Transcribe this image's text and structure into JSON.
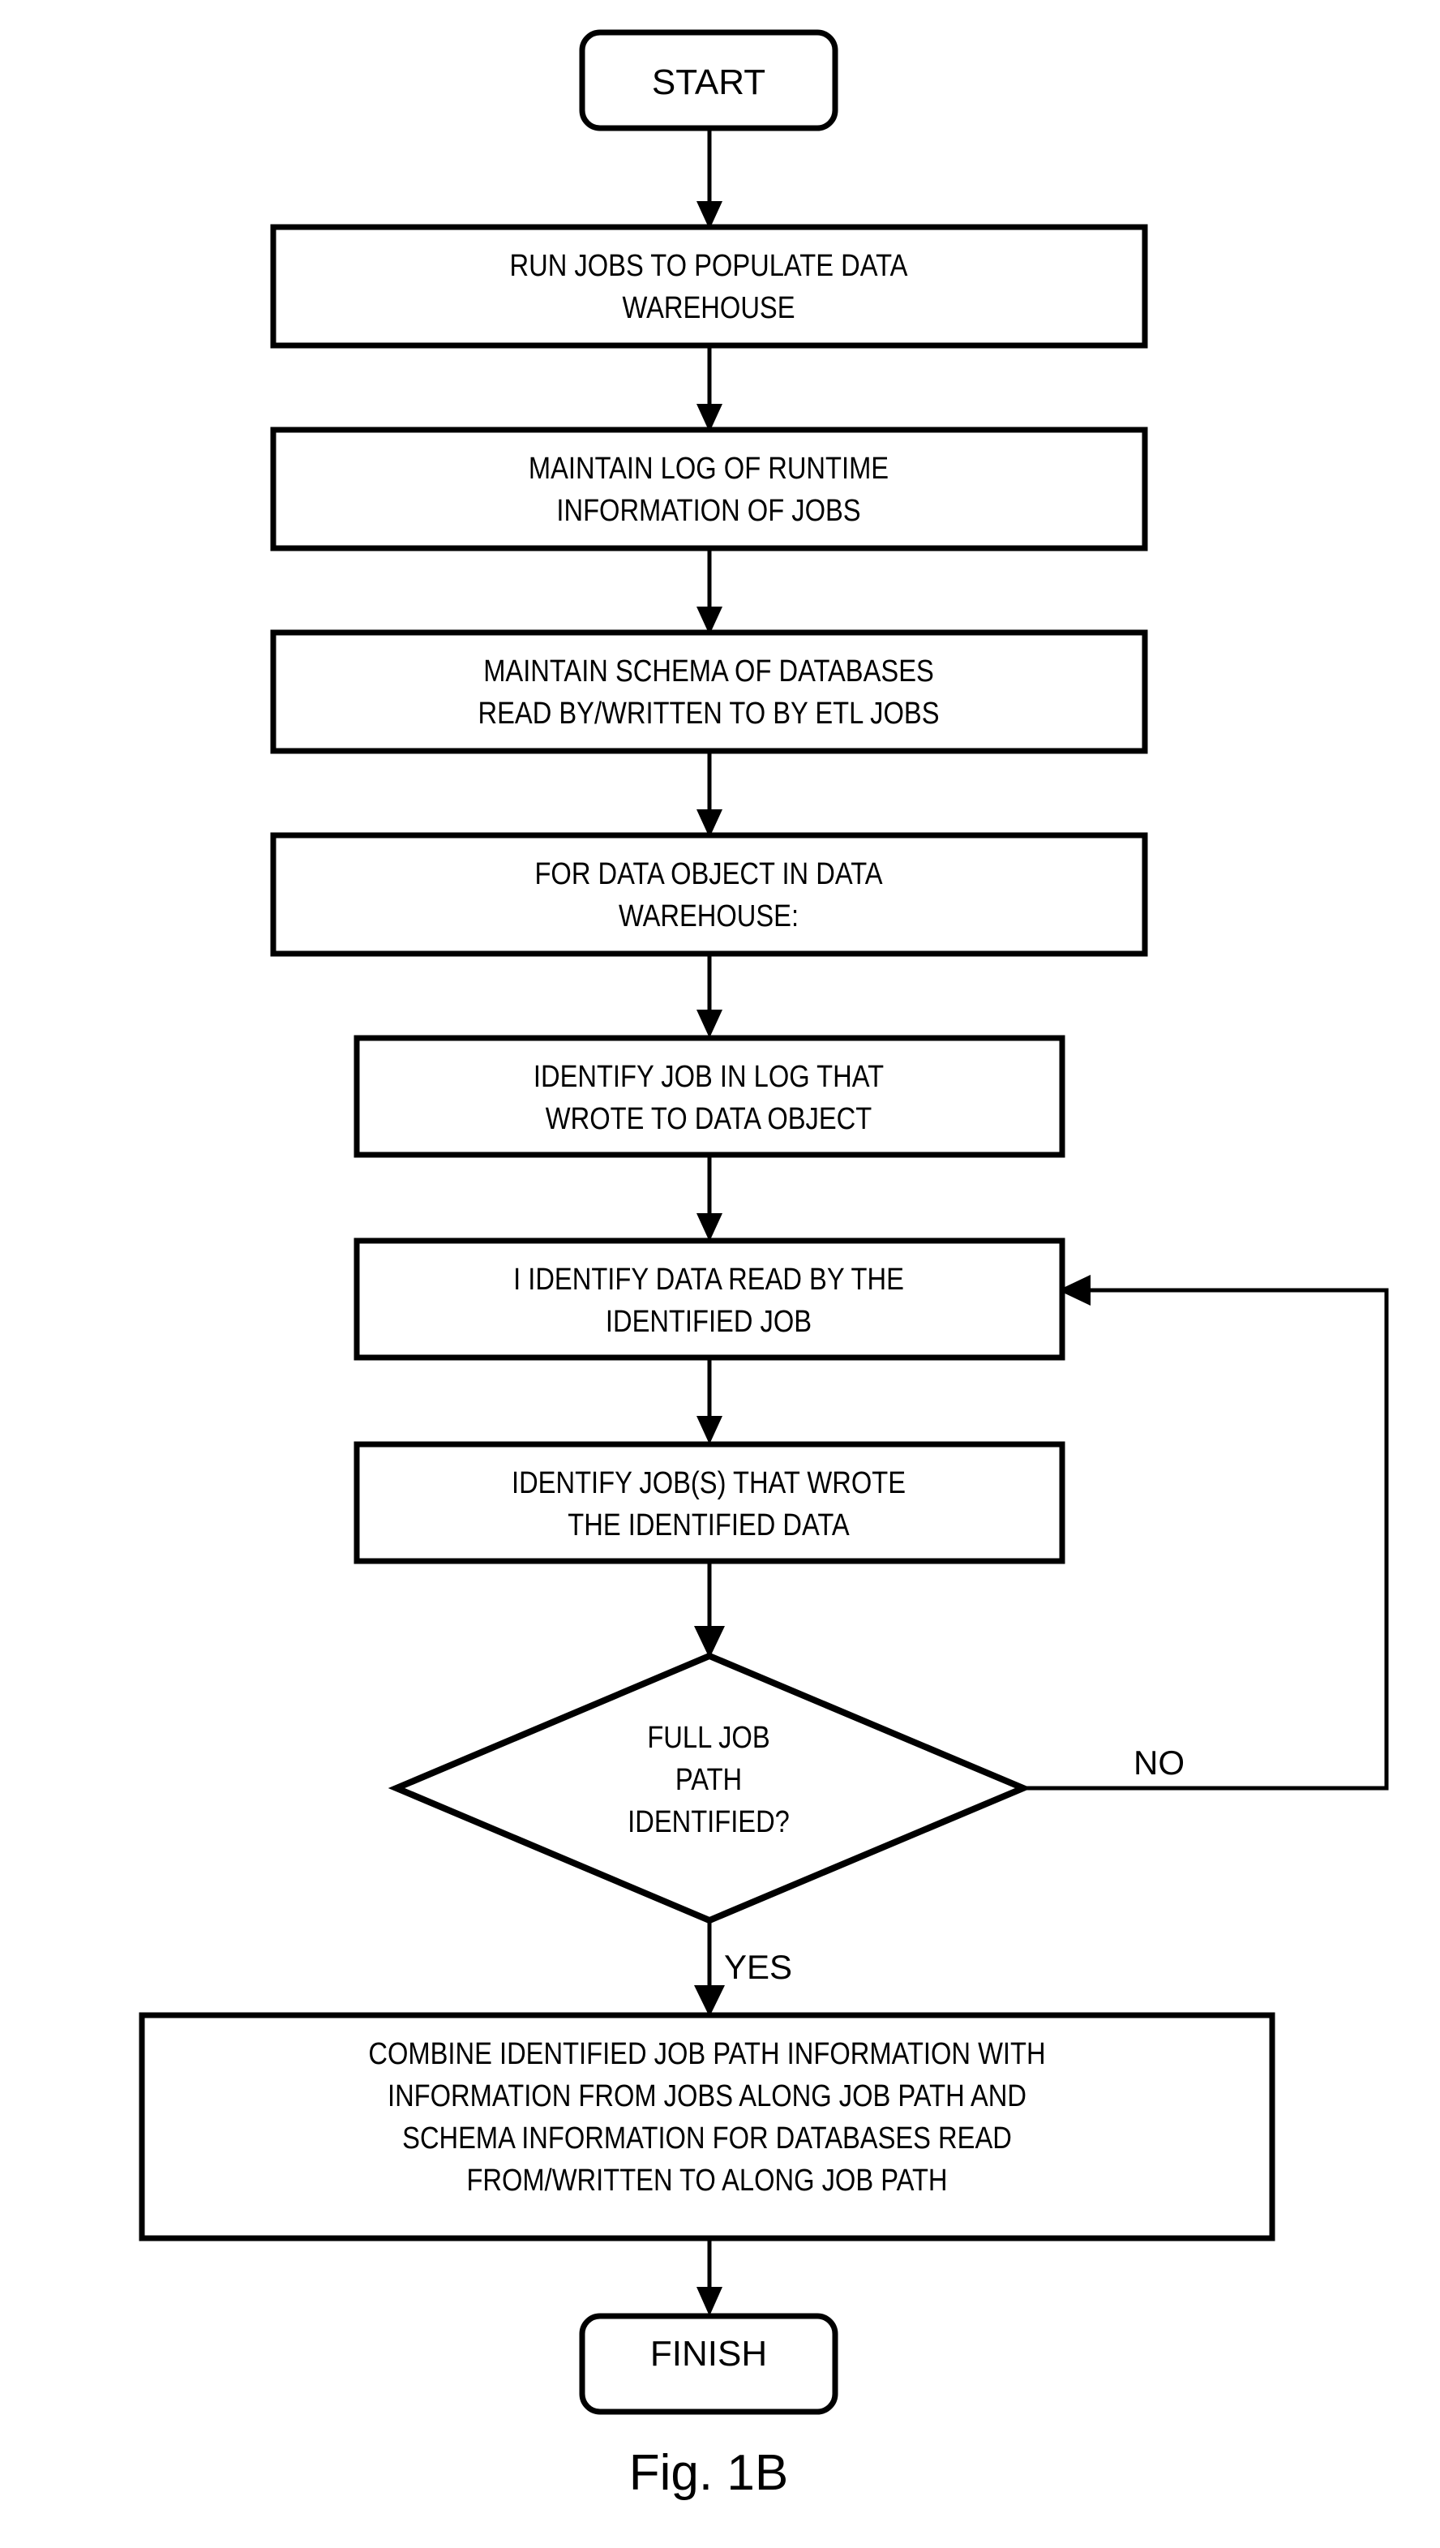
{
  "figure": {
    "caption": "Fig. 1B",
    "title": "ETL job path lineage flowchart"
  },
  "colors": {
    "stroke": "#000000",
    "fill": "#ffffff",
    "text": "#000000",
    "background": "#ffffff"
  },
  "nodes": {
    "start": {
      "id": "start",
      "type": "terminator",
      "label": "START"
    },
    "run_jobs": {
      "id": "run_jobs",
      "type": "process",
      "lines": [
        "RUN JOBS TO POPULATE DATA",
        "WAREHOUSE"
      ]
    },
    "maintain_log": {
      "id": "maintain_log",
      "type": "process",
      "lines": [
        "MAINTAIN LOG OF RUNTIME",
        "INFORMATION OF JOBS"
      ]
    },
    "maintain_schema": {
      "id": "maintain_schema",
      "type": "process",
      "lines": [
        "MAINTAIN SCHEMA OF DATABASES",
        "READ BY/WRITTEN TO BY ETL JOBS"
      ]
    },
    "for_data_object": {
      "id": "for_data_object",
      "type": "process",
      "lines": [
        "FOR DATA OBJECT IN DATA",
        "WAREHOUSE:"
      ]
    },
    "identify_job_in_log": {
      "id": "identify_job_in_log",
      "type": "process",
      "lines": [
        "IDENTIFY JOB IN LOG THAT",
        "WROTE TO DATA OBJECT"
      ]
    },
    "identify_data_read": {
      "id": "identify_data_read",
      "type": "process",
      "lines": [
        "I IDENTIFY DATA READ BY THE",
        "IDENTIFIED JOB"
      ]
    },
    "identify_jobs_wrote": {
      "id": "identify_jobs_wrote",
      "type": "process",
      "lines": [
        "IDENTIFY JOB(S) THAT WROTE",
        "THE IDENTIFIED DATA"
      ]
    },
    "full_job_path": {
      "id": "full_job_path",
      "type": "decision",
      "lines": [
        "FULL JOB",
        "PATH",
        "IDENTIFIED?"
      ]
    },
    "combine": {
      "id": "combine",
      "type": "process",
      "lines": [
        "COMBINE IDENTIFIED JOB PATH INFORMATION WITH",
        "INFORMATION FROM JOBS ALONG JOB PATH AND",
        "SCHEMA INFORMATION FOR DATABASES READ",
        "FROM/WRITTEN TO ALONG JOB PATH"
      ]
    },
    "finish": {
      "id": "finish",
      "type": "terminator",
      "label": "FINISH"
    }
  },
  "edges": [
    {
      "id": "e1",
      "from": "start",
      "to": "run_jobs",
      "label": ""
    },
    {
      "id": "e2",
      "from": "run_jobs",
      "to": "maintain_log",
      "label": ""
    },
    {
      "id": "e3",
      "from": "maintain_log",
      "to": "maintain_schema",
      "label": ""
    },
    {
      "id": "e4",
      "from": "maintain_schema",
      "to": "for_data_object",
      "label": ""
    },
    {
      "id": "e5",
      "from": "for_data_object",
      "to": "identify_job_in_log",
      "label": ""
    },
    {
      "id": "e6",
      "from": "identify_job_in_log",
      "to": "identify_data_read",
      "label": ""
    },
    {
      "id": "e7",
      "from": "identify_data_read",
      "to": "identify_jobs_wrote",
      "label": ""
    },
    {
      "id": "e8",
      "from": "identify_jobs_wrote",
      "to": "full_job_path",
      "label": ""
    },
    {
      "id": "e9",
      "from": "full_job_path",
      "to": "combine",
      "label": "YES"
    },
    {
      "id": "e10",
      "from": "full_job_path",
      "to": "identify_data_read",
      "label": "NO"
    },
    {
      "id": "e11",
      "from": "combine",
      "to": "finish",
      "label": ""
    }
  ],
  "edge_labels": {
    "yes": "YES",
    "no": "NO"
  }
}
